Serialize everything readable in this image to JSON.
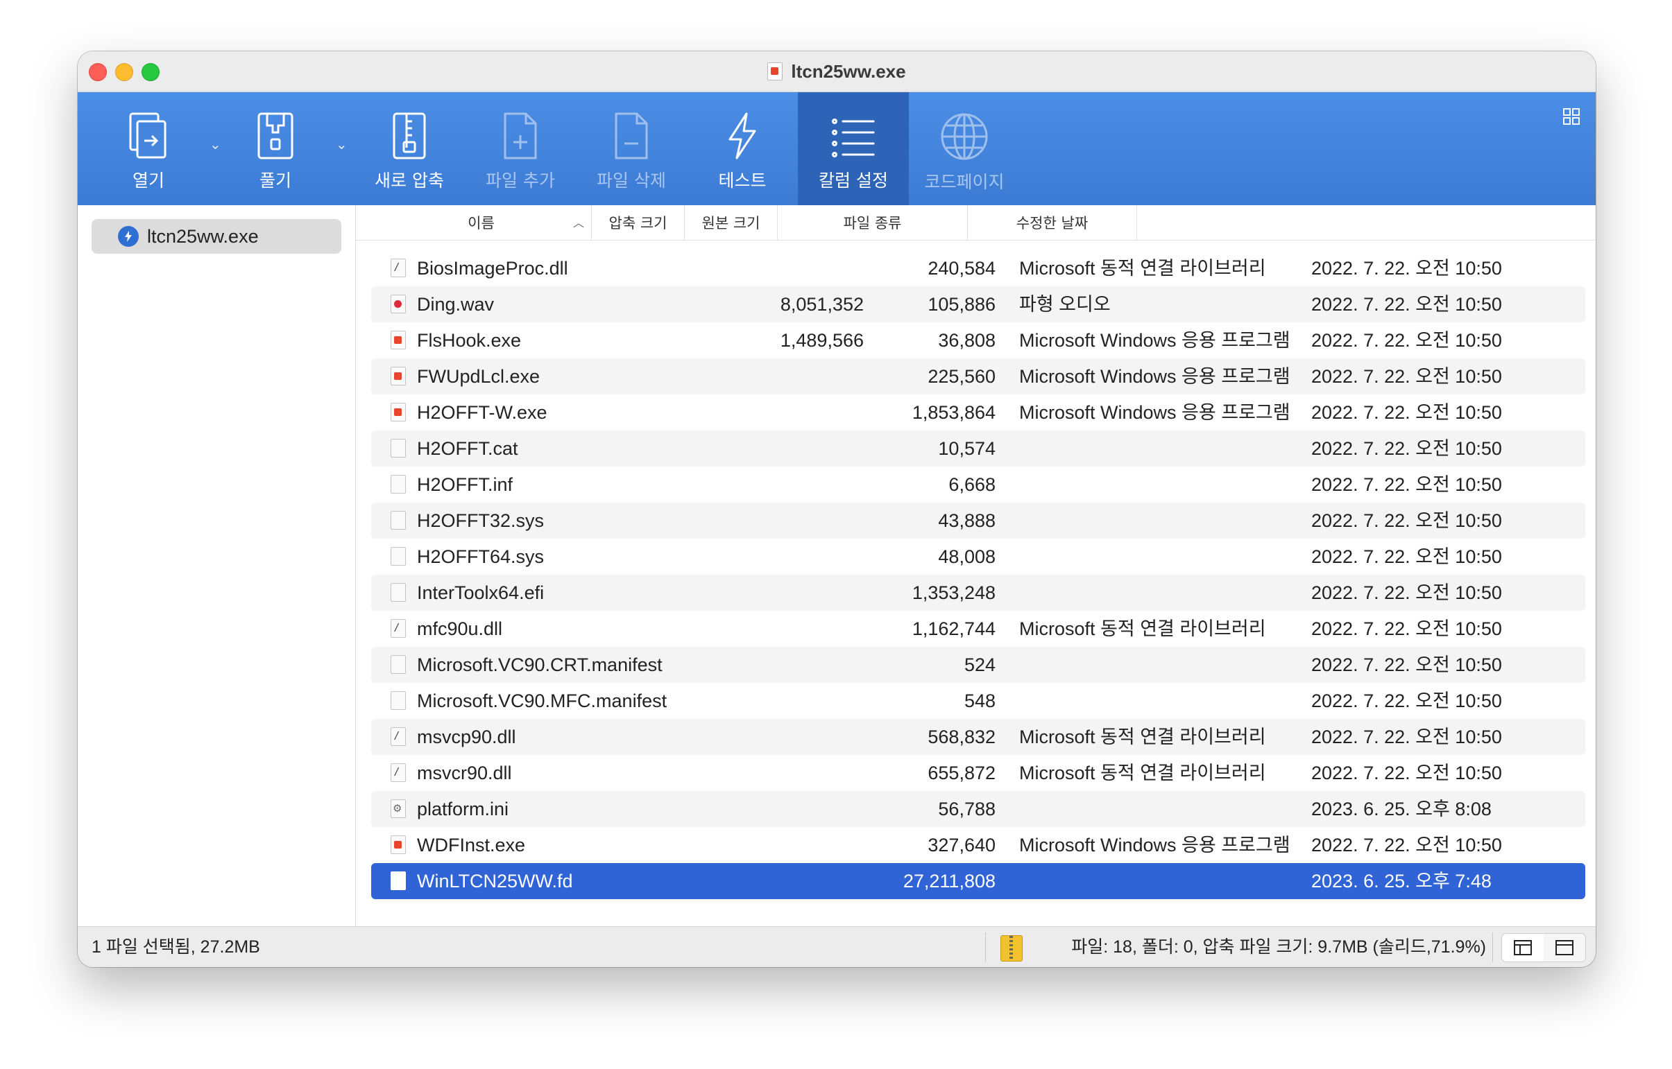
{
  "window": {
    "title": "ltcn25ww.exe"
  },
  "toolbar": {
    "open": "열기",
    "extract": "풀기",
    "new_archive": "새로 압축",
    "add_file": "파일 추가",
    "delete_file": "파일 삭제",
    "test": "테스트",
    "column_settings": "칼럼 설정",
    "codepage": "코드페이지"
  },
  "sidebar": {
    "items": [
      {
        "label": "ltcn25ww.exe"
      }
    ]
  },
  "table": {
    "columns": {
      "name": "이름",
      "compressed": "압축 크기",
      "original": "원본 크기",
      "type": "파일 종류",
      "modified": "수정한 날짜"
    },
    "rows": [
      {
        "name": "BiosImageProc.dll",
        "icon": "dll",
        "compressed": "",
        "original": "240,584",
        "type": "Microsoft 동적 연결 라이브러리",
        "date": "2022. 7. 22. 오전 10:50"
      },
      {
        "name": "Ding.wav",
        "icon": "wav",
        "compressed": "8,051,352",
        "original": "105,886",
        "type": "파형 오디오",
        "date": "2022. 7. 22. 오전 10:50"
      },
      {
        "name": "FlsHook.exe",
        "icon": "exe",
        "compressed": "1,489,566",
        "original": "36,808",
        "type": "Microsoft Windows 응용 프로그램",
        "date": "2022. 7. 22. 오전 10:50"
      },
      {
        "name": "FWUpdLcl.exe",
        "icon": "exe",
        "compressed": "",
        "original": "225,560",
        "type": "Microsoft Windows 응용 프로그램",
        "date": "2022. 7. 22. 오전 10:50"
      },
      {
        "name": "H2OFFT-W.exe",
        "icon": "exe",
        "compressed": "",
        "original": "1,853,864",
        "type": "Microsoft Windows 응용 프로그램",
        "date": "2022. 7. 22. 오전 10:50"
      },
      {
        "name": "H2OFFT.cat",
        "icon": "blank",
        "compressed": "",
        "original": "10,574",
        "type": "",
        "date": "2022. 7. 22. 오전 10:50"
      },
      {
        "name": "H2OFFT.inf",
        "icon": "blank",
        "compressed": "",
        "original": "6,668",
        "type": "",
        "date": "2022. 7. 22. 오전 10:50"
      },
      {
        "name": "H2OFFT32.sys",
        "icon": "blank",
        "compressed": "",
        "original": "43,888",
        "type": "",
        "date": "2022. 7. 22. 오전 10:50"
      },
      {
        "name": "H2OFFT64.sys",
        "icon": "blank",
        "compressed": "",
        "original": "48,008",
        "type": "",
        "date": "2022. 7. 22. 오전 10:50"
      },
      {
        "name": "InterToolx64.efi",
        "icon": "blank",
        "compressed": "",
        "original": "1,353,248",
        "type": "",
        "date": "2022. 7. 22. 오전 10:50"
      },
      {
        "name": "mfc90u.dll",
        "icon": "dll",
        "compressed": "",
        "original": "1,162,744",
        "type": "Microsoft 동적 연결 라이브러리",
        "date": "2022. 7. 22. 오전 10:50"
      },
      {
        "name": "Microsoft.VC90.CRT.manifest",
        "icon": "blank",
        "compressed": "",
        "original": "524",
        "type": "",
        "date": "2022. 7. 22. 오전 10:50"
      },
      {
        "name": "Microsoft.VC90.MFC.manifest",
        "icon": "blank",
        "compressed": "",
        "original": "548",
        "type": "",
        "date": "2022. 7. 22. 오전 10:50"
      },
      {
        "name": "msvcp90.dll",
        "icon": "dll",
        "compressed": "",
        "original": "568,832",
        "type": "Microsoft 동적 연결 라이브러리",
        "date": "2022. 7. 22. 오전 10:50"
      },
      {
        "name": "msvcr90.dll",
        "icon": "dll",
        "compressed": "",
        "original": "655,872",
        "type": "Microsoft 동적 연결 라이브러리",
        "date": "2022. 7. 22. 오전 10:50"
      },
      {
        "name": "platform.ini",
        "icon": "ini",
        "compressed": "",
        "original": "56,788",
        "type": "",
        "date": "2023. 6. 25. 오후 8:08"
      },
      {
        "name": "WDFInst.exe",
        "icon": "exe",
        "compressed": "",
        "original": "327,640",
        "type": "Microsoft Windows 응용 프로그램",
        "date": "2022. 7. 22. 오전 10:50"
      },
      {
        "name": "WinLTCN25WW.fd",
        "icon": "blank",
        "compressed": "",
        "original": "27,211,808",
        "type": "",
        "date": "2023. 6. 25. 오후 7:48",
        "selected": true
      }
    ]
  },
  "status": {
    "selection": "1 파일 선택됨, 27.2MB",
    "summary": "파일: 18, 폴더: 0, 압축 파일 크기: 9.7MB (솔리드,71.9%)"
  },
  "colors": {
    "toolbar": "#3c7bd4",
    "selection": "#2f63d6",
    "active_tool": "#2d64b8"
  }
}
